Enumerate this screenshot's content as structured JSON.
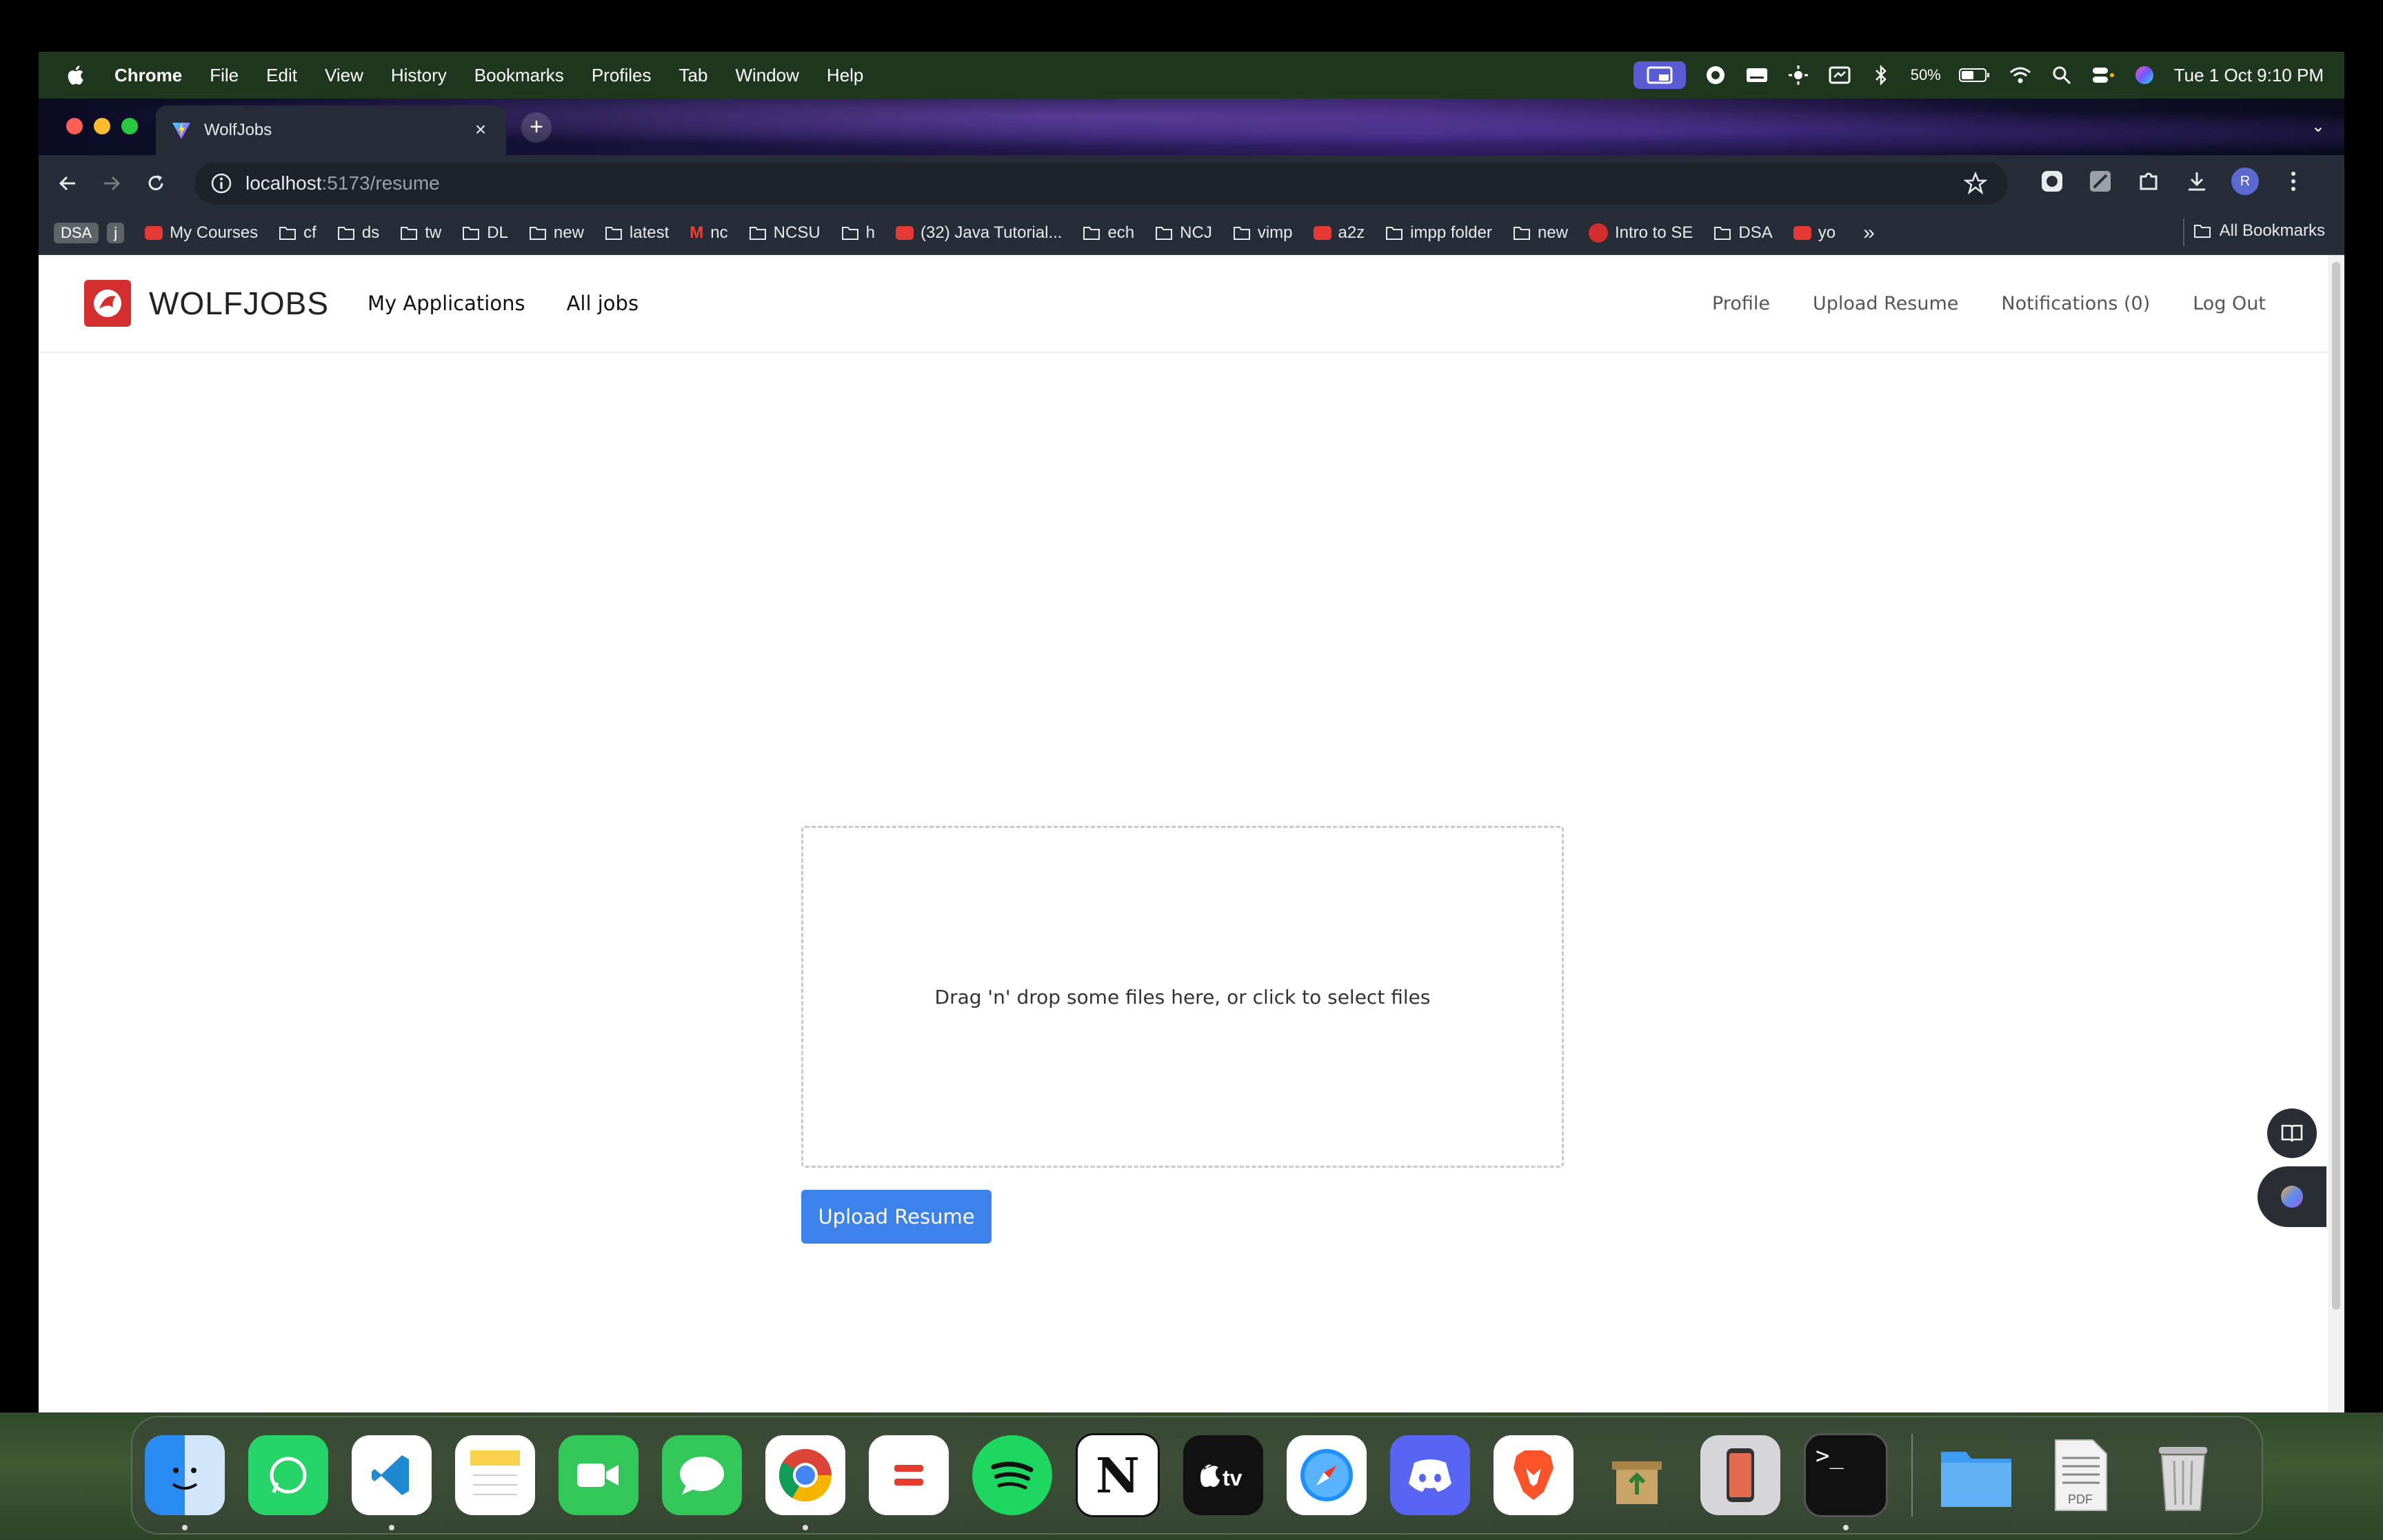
{
  "menubar": {
    "app_name": "Chrome",
    "items": [
      "File",
      "Edit",
      "View",
      "History",
      "Bookmarks",
      "Profiles",
      "Tab",
      "Window",
      "Help"
    ],
    "battery": "50%",
    "datetime": "Tue 1 Oct  9:10 PM"
  },
  "browser": {
    "tab_title": "WolfJobs",
    "url_host": "localhost",
    "url_path": ":5173/resume",
    "avatar_letter": "R",
    "bookmarks": [
      {
        "label": "DSA",
        "kind": "badge"
      },
      {
        "label": "j",
        "kind": "badge"
      },
      {
        "label": "My Courses",
        "kind": "site"
      },
      {
        "label": "cf",
        "kind": "folder"
      },
      {
        "label": "ds",
        "kind": "folder"
      },
      {
        "label": "tw",
        "kind": "folder"
      },
      {
        "label": "DL",
        "kind": "folder"
      },
      {
        "label": "new",
        "kind": "folder"
      },
      {
        "label": "latest",
        "kind": "folder"
      },
      {
        "label": "nc",
        "kind": "gmail"
      },
      {
        "label": "NCSU",
        "kind": "folder"
      },
      {
        "label": "h",
        "kind": "folder"
      },
      {
        "label": "(32) Java Tutorial...",
        "kind": "youtube"
      },
      {
        "label": "ech",
        "kind": "folder"
      },
      {
        "label": "NCJ",
        "kind": "folder"
      },
      {
        "label": "vimp",
        "kind": "folder"
      },
      {
        "label": "a2z",
        "kind": "youtube"
      },
      {
        "label": "impp folder",
        "kind": "folder"
      },
      {
        "label": "new",
        "kind": "folder"
      },
      {
        "label": "Intro to SE",
        "kind": "site"
      },
      {
        "label": "DSA",
        "kind": "folder"
      },
      {
        "label": "yo",
        "kind": "site"
      }
    ],
    "overflow": "»",
    "all_bookmarks": "All Bookmarks"
  },
  "app": {
    "brand": "WOLFJOBS",
    "nav_left": [
      "My Applications",
      "All jobs"
    ],
    "nav_right": [
      "Profile",
      "Upload Resume",
      "Notifications (0)",
      "Log Out"
    ],
    "dropzone_text": "Drag 'n' drop some files here, or click to select files",
    "upload_button": "Upload Resume"
  },
  "colors": {
    "brand_red": "#d32f2f",
    "button_blue": "#3c82ea"
  },
  "dock": [
    "Finder",
    "WhatsApp",
    "Visual Studio Code",
    "Notes",
    "FaceTime",
    "Messages",
    "Google Chrome",
    "Calculator",
    "Spotify",
    "Notion",
    "Apple TV",
    "Safari",
    "Discord",
    "Brave",
    "Archive Utility",
    "iPhone Mirroring",
    "Terminal",
    "Folder",
    "PDF Document",
    "Trash"
  ]
}
